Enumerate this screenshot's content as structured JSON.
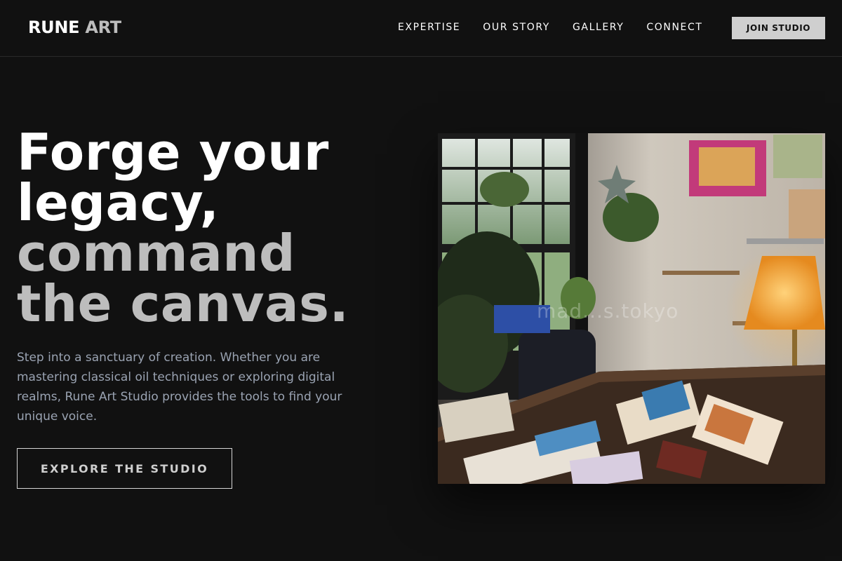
{
  "header": {
    "logo_primary": "RUNE",
    "logo_secondary": "ART",
    "nav": [
      "EXPERTISE",
      "OUR STORY",
      "GALLERY",
      "CONNECT"
    ],
    "cta_label": "JOIN STUDIO"
  },
  "hero": {
    "headline_lines": [
      "Forge your",
      "legacy,",
      "command",
      "the canvas."
    ],
    "description": "Step into a sanctuary of creation. Whether you are mastering classical oil techniques or exploring digital realms, Rune Art Studio provides the tools to find your unique voice.",
    "cta_label": "EXPLORE THE STUDIO",
    "image_watermark": "mad...s.tokyo"
  },
  "colors": {
    "background": "#111111",
    "accent_gray": "#bdbdbd",
    "body_text": "#9aa3b2",
    "button_bg": "#cfcfcf"
  }
}
